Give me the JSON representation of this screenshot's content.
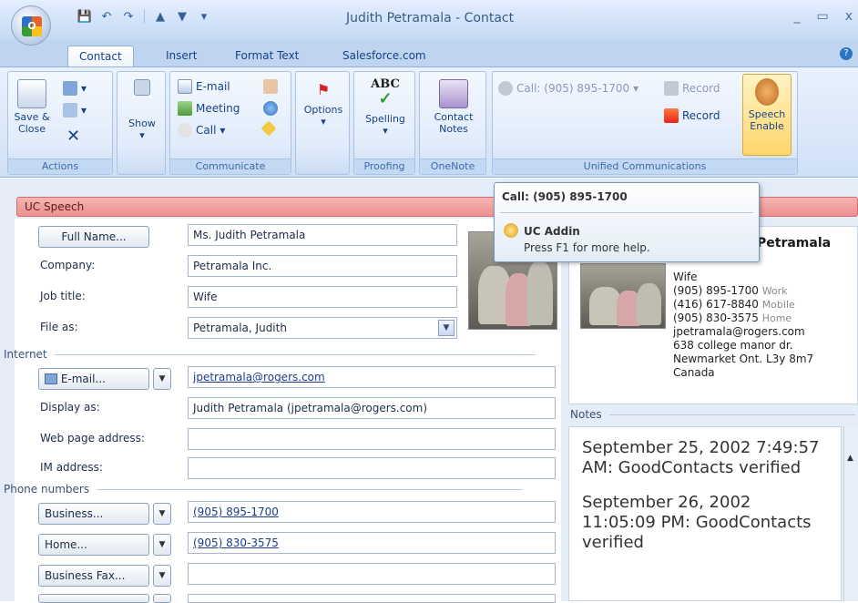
{
  "window": {
    "title": "Judith Petramala - Contact",
    "minimize": "_",
    "maximize": "▭",
    "close": "x"
  },
  "qat": [
    "save-icon",
    "undo-icon",
    "redo-icon",
    "previous-icon",
    "next-icon",
    "customize-icon"
  ],
  "tabs": [
    {
      "label": "Contact",
      "active": true
    },
    {
      "label": "Insert",
      "active": false
    },
    {
      "label": "Format Text",
      "active": false
    },
    {
      "label": "Salesforce.com",
      "active": false
    }
  ],
  "ribbon": {
    "actions": {
      "label": "Actions",
      "save_close": "Save &\nClose"
    },
    "show": {
      "label": "Show"
    },
    "communicate": {
      "label": "Communicate",
      "email": "E-mail",
      "meeting": "Meeting",
      "call": "Call"
    },
    "options": {
      "label": "Options"
    },
    "proofing": {
      "label": "Proofing",
      "spelling": "Spelling"
    },
    "onenote": {
      "label": "OneNote",
      "contact_notes": "Contact Notes"
    },
    "unified": {
      "label": "Unified Communications",
      "call": "Call: (905) 895-1700",
      "record_top": "Record",
      "record": "Record",
      "speech_enable": "Speech Enable"
    }
  },
  "uc_bar": "UC Speech",
  "form": {
    "full_name_button": "Full Name...",
    "full_name": "Ms. Judith Petramala",
    "company_label": "Company:",
    "company": "Petramala Inc.",
    "job_title_label": "Job title:",
    "job_title": "Wife",
    "file_as_label": "File as:",
    "file_as": "Petramala, Judith",
    "internet_section": "Internet",
    "email_button": "E-mail...",
    "email": "jpetramala@rogers.com",
    "display_as_label": "Display as:",
    "display_as": "Judith Petramala (jpetramala@rogers.com)",
    "web_label": "Web page address:",
    "web": "",
    "im_label": "IM address:",
    "im": "",
    "phone_section": "Phone numbers",
    "business_button": "Business...",
    "business": "(905) 895-1700",
    "home_button": "Home...",
    "home": "(905) 830-3575",
    "bfax_button": "Business Fax...",
    "bfax": ""
  },
  "card": {
    "name": "Petramala",
    "title": "Wife",
    "phone_work": "(905) 895-1700",
    "phone_work_tag": "Work",
    "phone_mobile": "(416) 617-8840",
    "phone_mobile_tag": "Mobile",
    "phone_home": "(905) 830-3575",
    "phone_home_tag": "Home",
    "email": "jpetramala@rogers.com",
    "address1": "638 college manor dr.",
    "address2": "Newmarket  Ont.  L3y 8m7",
    "country": "Canada"
  },
  "notes": {
    "label": "Notes",
    "line1": "September 25, 2002 7:49:57 AM: GoodContacts verified",
    "line2": "September 26, 2002 11:05:09 PM: GoodContacts verified"
  },
  "tooltip": {
    "title": "Call: (905) 895-1700",
    "addin": "UC Addin",
    "help": "Press F1 for more help."
  },
  "colors": {
    "uc_bar": "#ec8f8f",
    "accent": "#15428b"
  }
}
